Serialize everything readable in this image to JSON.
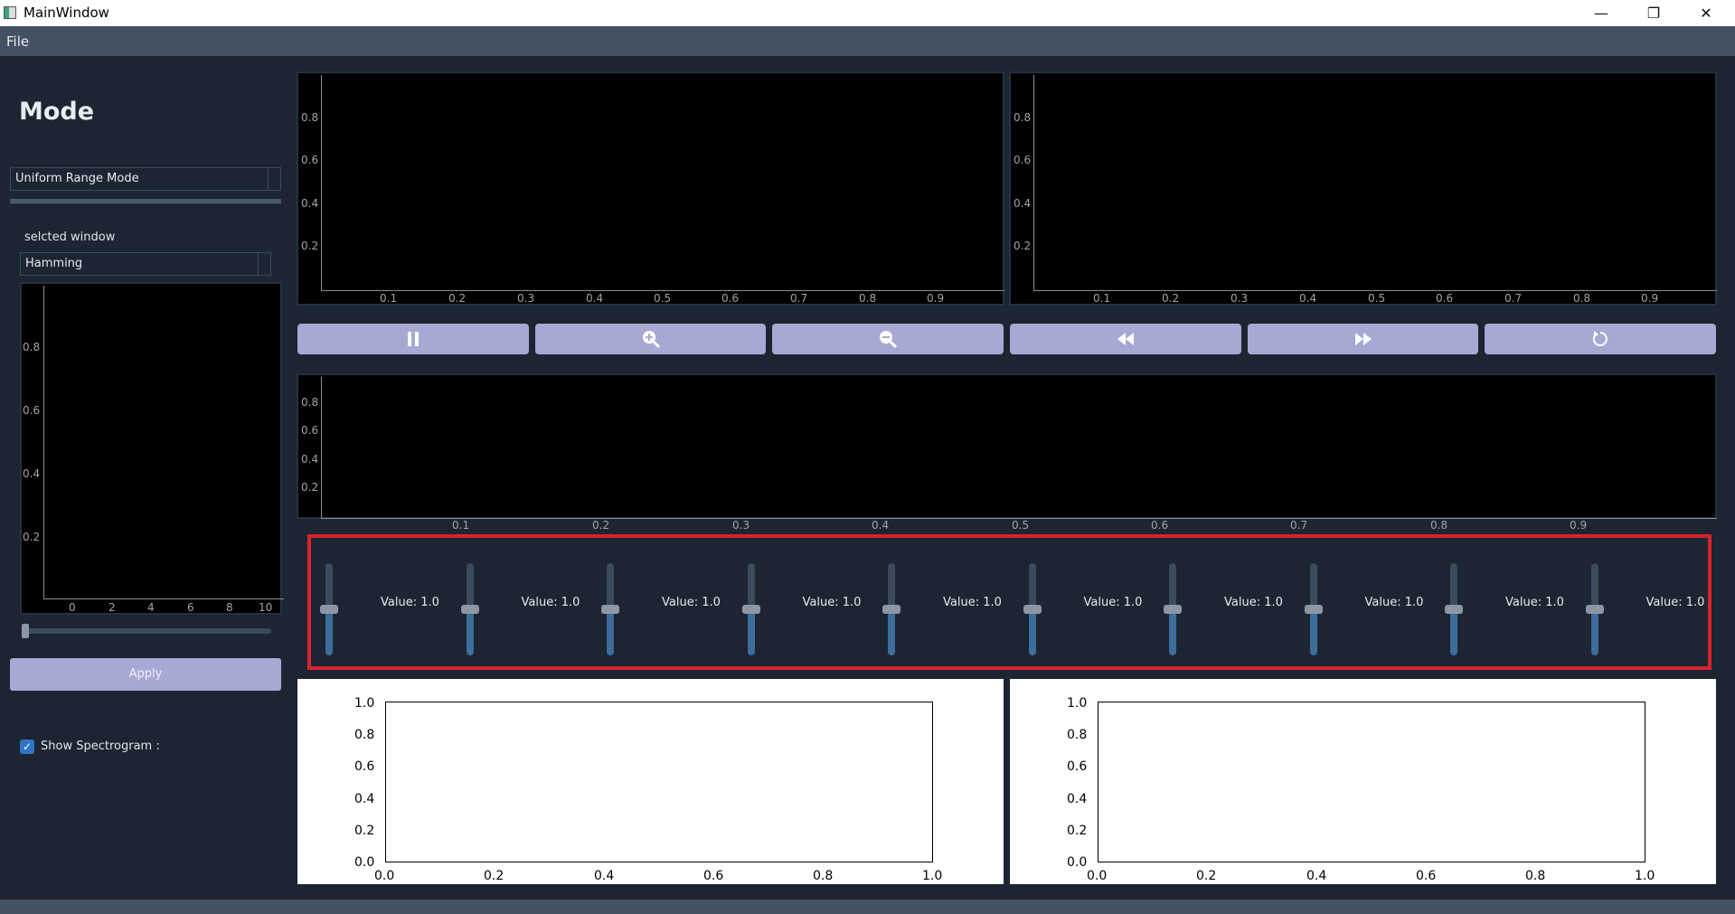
{
  "window": {
    "title": "MainWindow",
    "minimize_glyph": "—",
    "restore_glyph": "❐",
    "close_glyph": "✕"
  },
  "menubar": {
    "file_label": "File"
  },
  "left_panel": {
    "mode_heading": "Mode",
    "mode_combo_value": "Uniform Range Mode",
    "window_label": "selcted window",
    "window_combo_value": "Hamming",
    "window_plot": {
      "y_ticks": [
        "0.8",
        "0.6",
        "0.4",
        "0.2"
      ],
      "x_ticks": [
        "0",
        "2",
        "4",
        "6",
        "8",
        "10"
      ]
    },
    "apply_label": "Apply",
    "spectrogram_label": "Show Spectrogram :",
    "spectrogram_checked": true
  },
  "plots": {
    "input_signal": {
      "y_ticks": [
        "0.8",
        "0.6",
        "0.4",
        "0.2"
      ],
      "x_ticks": [
        "0.1",
        "0.2",
        "0.3",
        "0.4",
        "0.5",
        "0.6",
        "0.7",
        "0.8",
        "0.9"
      ]
    },
    "output_signal": {
      "y_ticks": [
        "0.8",
        "0.6",
        "0.4",
        "0.2"
      ],
      "x_ticks": [
        "0.1",
        "0.2",
        "0.3",
        "0.4",
        "0.5",
        "0.6",
        "0.7",
        "0.8",
        "0.9"
      ]
    },
    "frequency_plot": {
      "y_ticks": [
        "0.8",
        "0.6",
        "0.4",
        "0.2"
      ],
      "x_ticks": [
        "0.1",
        "0.2",
        "0.3",
        "0.4",
        "0.5",
        "0.6",
        "0.7",
        "0.8",
        "0.9"
      ]
    },
    "spectrogram_left": {
      "y_ticks": [
        "1.0",
        "0.8",
        "0.6",
        "0.4",
        "0.2",
        "0.0"
      ],
      "x_ticks": [
        "0.0",
        "0.2",
        "0.4",
        "0.6",
        "0.8",
        "1.0"
      ]
    },
    "spectrogram_right": {
      "y_ticks": [
        "1.0",
        "0.8",
        "0.6",
        "0.4",
        "0.2",
        "0.0"
      ],
      "x_ticks": [
        "0.0",
        "0.2",
        "0.4",
        "0.6",
        "0.8",
        "1.0"
      ]
    }
  },
  "controls": [
    {
      "name": "pause-button",
      "icon": "pause-icon"
    },
    {
      "name": "zoom-in-button",
      "icon": "zoom-in-icon"
    },
    {
      "name": "zoom-out-button",
      "icon": "zoom-out-icon"
    },
    {
      "name": "rewind-button",
      "icon": "rewind-icon"
    },
    {
      "name": "fast-forward-button",
      "icon": "fast-forward-icon"
    },
    {
      "name": "reset-button",
      "icon": "reset-icon"
    }
  ],
  "equalizer": {
    "sliders": [
      {
        "label": "Value: 1.0",
        "level": 0.5
      },
      {
        "label": "Value: 1.0",
        "level": 0.5
      },
      {
        "label": "Value: 1.0",
        "level": 0.5
      },
      {
        "label": "Value: 1.0",
        "level": 0.5
      },
      {
        "label": "Value: 1.0",
        "level": 0.5
      },
      {
        "label": "Value: 1.0",
        "level": 0.5
      },
      {
        "label": "Value: 1.0",
        "level": 0.5
      },
      {
        "label": "Value: 1.0",
        "level": 0.5
      },
      {
        "label": "Value: 1.0",
        "level": 0.5
      },
      {
        "label": "Value: 1.0",
        "level": 0.5
      }
    ]
  },
  "colors": {
    "background": "#1c2531",
    "button": "#a8a8d4",
    "highlight_border": "#d9232d",
    "slider_fill": "#3c6d9c"
  }
}
